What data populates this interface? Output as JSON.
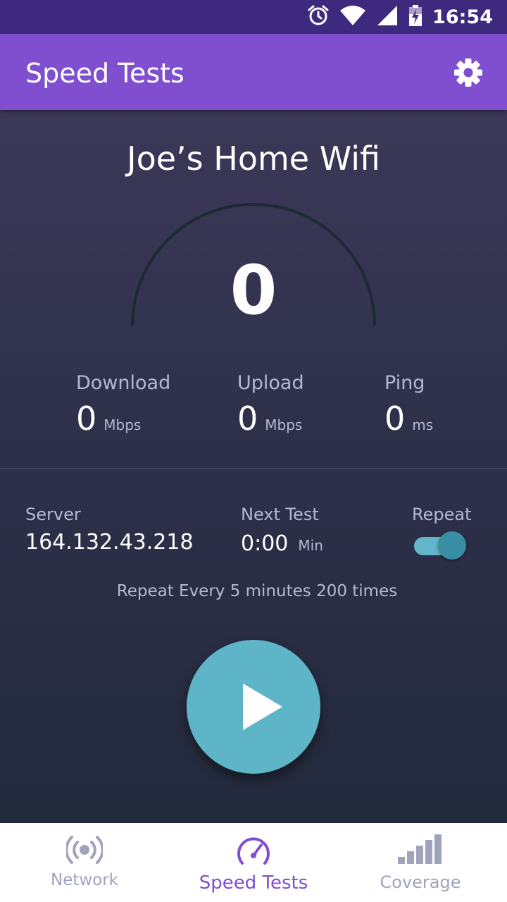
{
  "status_bar": {
    "time": "16:54"
  },
  "app_bar": {
    "title": "Speed Tests"
  },
  "network_name": "Joe’s Home Wifi",
  "gauge": {
    "value": "0"
  },
  "metrics": {
    "download": {
      "label": "Download",
      "value": "0",
      "unit": "Mbps"
    },
    "upload": {
      "label": "Upload",
      "value": "0",
      "unit": "Mbps"
    },
    "ping": {
      "label": "Ping",
      "value": "0",
      "unit": "ms"
    }
  },
  "info": {
    "server_label": "Server",
    "server_value": "164.132.43.218",
    "next_label": "Next Test",
    "next_value": "0:00",
    "next_unit": "Min",
    "repeat_label": "Repeat",
    "repeat_on": true,
    "repeat_desc": "Repeat Every 5 minutes 200 times"
  },
  "bottom_nav": [
    {
      "label": "Network",
      "icon": "broadcast-icon",
      "active": false
    },
    {
      "label": "Speed Tests",
      "icon": "speedometer-icon",
      "active": true
    },
    {
      "label": "Coverage",
      "icon": "signal-bars-icon",
      "active": false
    }
  ],
  "colors": {
    "status_bar": "#3d2a7e",
    "app_bar": "#7f4fd0",
    "accent": "#5fb5c8",
    "nav_active": "#7f4fd0",
    "nav_inactive": "#a1a3bd"
  }
}
